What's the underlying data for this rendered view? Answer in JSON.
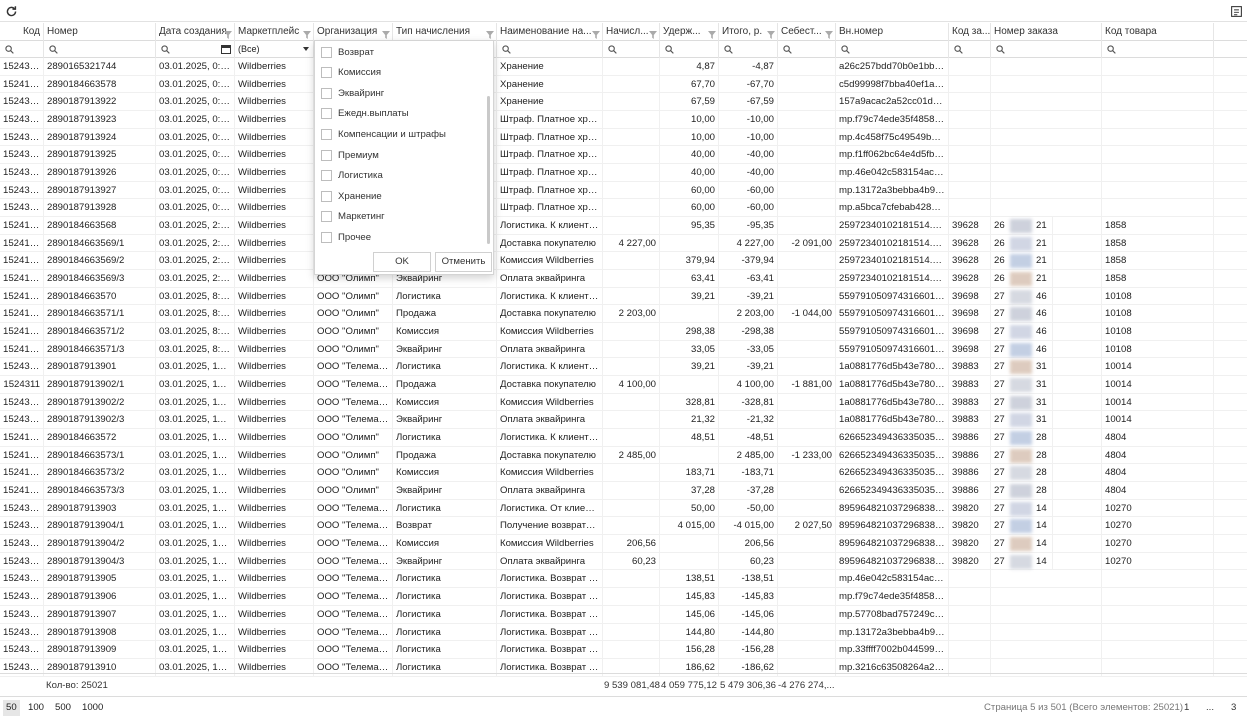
{
  "toolbar": {
    "refresh_icon": "refresh-icon",
    "export_icon": "export-icon"
  },
  "columns": [
    {
      "label": "Код"
    },
    {
      "label": "Номер"
    },
    {
      "label": "Дата создания"
    },
    {
      "label": "Маркетплейс"
    },
    {
      "label": "Организация"
    },
    {
      "label": "Тип начисления"
    },
    {
      "label": "Наименование на..."
    },
    {
      "label": "Начисл..."
    },
    {
      "label": "Удерж..."
    },
    {
      "label": "Итого, р."
    },
    {
      "label": "Себест..."
    },
    {
      "label": "Вн.номер"
    },
    {
      "label": "Код за..."
    },
    {
      "label": "Номер заказа"
    },
    {
      "label": "Код товара"
    }
  ],
  "filter": {
    "marketplace_value": "(Все)"
  },
  "rows": [
    [
      "1524392",
      "2890165321744",
      "03.01.2025, 0:00",
      "Wildberries",
      "",
      "",
      "Хранение",
      "",
      "4,87",
      "-4,87",
      "",
      "a26c257bdd70b0e1bbe...",
      "",
      "",
      ""
    ],
    [
      "1524185",
      "2890184663578",
      "03.01.2025, 0:00",
      "Wildberries",
      "",
      "",
      "Хранение",
      "",
      "67,70",
      "-67,70",
      "",
      "c5d99998f7bba40ef1a6...",
      "",
      "",
      ""
    ],
    [
      "1524327",
      "2890187913922",
      "03.01.2025, 0:00",
      "Wildberries",
      "",
      "",
      "Хранение",
      "",
      "67,59",
      "-67,59",
      "",
      "157a9acac2a52cc01dc7...",
      "",
      "",
      ""
    ],
    [
      "1524328",
      "2890187913923",
      "03.01.2025, 0:00",
      "Wildberries",
      "",
      "",
      "Штраф. Платное хра...",
      "",
      "10,00",
      "-10,00",
      "",
      "mp.f79c74ede35f48588...",
      "",
      "",
      ""
    ],
    [
      "1524329",
      "2890187913924",
      "03.01.2025, 0:00",
      "Wildberries",
      "",
      "",
      "Штраф. Платное хра...",
      "",
      "10,00",
      "-10,00",
      "",
      "mp.4c458f75c49549bca...",
      "",
      "",
      ""
    ],
    [
      "1524330",
      "2890187913925",
      "03.01.2025, 0:00",
      "Wildberries",
      "",
      "",
      "Штраф. Платное хра...",
      "",
      "40,00",
      "-40,00",
      "",
      "mp.f1ff062bc64e4d5fb6...",
      "",
      "",
      ""
    ],
    [
      "1524331",
      "2890187913926",
      "03.01.2025, 0:00",
      "Wildberries",
      "",
      "",
      "Штраф. Платное хра...",
      "",
      "40,00",
      "-40,00",
      "",
      "mp.46e042c583154acd...",
      "",
      "",
      ""
    ],
    [
      "1524332",
      "2890187913927",
      "03.01.2025, 0:00",
      "Wildberries",
      "",
      "",
      "Штраф. Платное хра...",
      "",
      "60,00",
      "-60,00",
      "",
      "mp.13172a3bebba4b94...",
      "",
      "",
      ""
    ],
    [
      "1524333",
      "2890187913928",
      "03.01.2025, 0:00",
      "Wildberries",
      "",
      "",
      "Штраф. Платное хра...",
      "",
      "60,00",
      "-60,00",
      "",
      "mp.a5bca7cfebab428b9...",
      "",
      "",
      ""
    ],
    [
      "1524173",
      "2890184663568",
      "03.01.2025, 2:30",
      "Wildberries",
      "",
      "",
      "Логистика. К клиенту...",
      "",
      "95,35",
      "-95,35",
      "",
      "25972340102181514.0.0",
      "39628",
      "26",
      "1858"
    ],
    [
      "1524174",
      "2890184663569/1",
      "03.01.2025, 2:30",
      "Wildberries",
      "",
      "",
      "Доставка покупателю",
      "4 227,00",
      "",
      "4 227,00",
      "-2 091,00",
      "25972340102181514.0.0",
      "39628",
      "26",
      "1858"
    ],
    [
      "1524175",
      "2890184663569/2",
      "03.01.2025, 2:30",
      "Wildberries",
      "",
      "",
      "Комиссия Wildberries",
      "",
      "379,94",
      "-379,94",
      "",
      "25972340102181514.0.0",
      "39628",
      "26",
      "1858"
    ],
    [
      "1524176",
      "2890184663569/3",
      "03.01.2025, 2:30",
      "Wildberries",
      "ООО \"Олимп\"",
      "Эквайринг",
      "Оплата эквайринга",
      "",
      "63,41",
      "-63,41",
      "",
      "25972340102181514.0.0",
      "39628",
      "26",
      "1858"
    ],
    [
      "1524177",
      "2890184663570",
      "03.01.2025, 8:59",
      "Wildberries",
      "ООО \"Олимп\"",
      "Логистика",
      "Логистика. К клиенту...",
      "",
      "39,21",
      "-39,21",
      "",
      "559791050974316601​0...",
      "39698",
      "27",
      "10108"
    ],
    [
      "1524178",
      "2890184663571/1",
      "03.01.2025, 8:59",
      "Wildberries",
      "ООО \"Олимп\"",
      "Продажа",
      "Доставка покупателю",
      "2 203,00",
      "",
      "2 203,00",
      "-1 044,00",
      "559791050974316601​0...",
      "39698",
      "27",
      "10108"
    ],
    [
      "1524179",
      "2890184663571/2",
      "03.01.2025, 8:59",
      "Wildberries",
      "ООО \"Олимп\"",
      "Комиссия",
      "Комиссия Wildberries",
      "",
      "298,38",
      "-298,38",
      "",
      "559791050974316601​0...",
      "39698",
      "27",
      "10108"
    ],
    [
      "1524180",
      "2890184663571/3",
      "03.01.2025, 8:59",
      "Wildberries",
      "ООО \"Олимп\"",
      "Эквайринг",
      "Оплата эквайринга",
      "",
      "33,05",
      "-33,05",
      "",
      "559791050974316601​0...",
      "39698",
      "27",
      "10108"
    ],
    [
      "1524310",
      "2890187913901",
      "03.01.2025, 11:00",
      "Wildberries",
      "ООО \"Телемак...",
      "Логистика",
      "Логистика. К клиенту...",
      "",
      "39,21",
      "-39,21",
      "",
      "1a0881776d5b43e780b...",
      "39883",
      "27",
      "10014"
    ],
    [
      "1524311",
      "2890187913902/1",
      "03.01.2025, 11:00",
      "Wildberries",
      "ООО \"Телемак...",
      "Продажа",
      "Доставка покупателю",
      "4 100,00",
      "",
      "4 100,00",
      "-1 881,00",
      "1a0881776d5b43e780b...",
      "39883",
      "27",
      "10014"
    ],
    [
      "1524312",
      "2890187913902/2",
      "03.01.2025, 11:00",
      "Wildberries",
      "ООО \"Телемак...",
      "Комиссия",
      "Комиссия Wildberries",
      "",
      "328,81",
      "-328,81",
      "",
      "1a0881776d5b43e780b...",
      "39883",
      "27",
      "10014"
    ],
    [
      "1524313",
      "2890187913902/3",
      "03.01.2025, 11:00",
      "Wildberries",
      "ООО \"Телемак...",
      "Эквайринг",
      "Оплата эквайринга",
      "",
      "21,32",
      "-21,32",
      "",
      "1a0881776d5b43e780b...",
      "39883",
      "27",
      "10014"
    ],
    [
      "1524181",
      "2890184663572",
      "03.01.2025, 15:43",
      "Wildberries",
      "ООО \"Олимп\"",
      "Логистика",
      "Логистика. К клиенту...",
      "",
      "48,51",
      "-48,51",
      "",
      "626652349436335035​3...",
      "39886",
      "27",
      "4804"
    ],
    [
      "1524182",
      "2890184663573/1",
      "03.01.2025, 15:43",
      "Wildberries",
      "ООО \"Олимп\"",
      "Продажа",
      "Доставка покупателю",
      "2 485,00",
      "",
      "2 485,00",
      "-1 233,00",
      "626652349436335035​3...",
      "39886",
      "27",
      "4804"
    ],
    [
      "1524183",
      "2890184663573/2",
      "03.01.2025, 15:43",
      "Wildberries",
      "ООО \"Олимп\"",
      "Комиссия",
      "Комиссия Wildberries",
      "",
      "183,71",
      "-183,71",
      "",
      "626652349436335035​3...",
      "39886",
      "27",
      "4804"
    ],
    [
      "1524184",
      "2890184663573/3",
      "03.01.2025, 15:43",
      "Wildberries",
      "ООО \"Олимп\"",
      "Эквайринг",
      "Оплата эквайринга",
      "",
      "37,28",
      "-37,28",
      "",
      "626652349436335035​3...",
      "39886",
      "27",
      "4804"
    ],
    [
      "1524314",
      "2890187913903",
      "03.01.2025, 16:36",
      "Wildberries",
      "ООО \"Телемак...",
      "Логистика",
      "Логистика. От клиент...",
      "",
      "50,00",
      "-50,00",
      "",
      "895964821037296838​2...",
      "39820",
      "27",
      "10270"
    ],
    [
      "1524315",
      "2890187913904/1",
      "03.01.2025, 16:36",
      "Wildberries",
      "ООО \"Телемак...",
      "Возврат",
      "Получение возврата,...",
      "",
      "4 015,00",
      "-4 015,00",
      "2 027,50",
      "895964821037296838​2...",
      "39820",
      "27",
      "10270"
    ],
    [
      "1524316",
      "2890187913904/2",
      "03.01.2025, 16:36",
      "Wildberries",
      "ООО \"Телемак...",
      "Комиссия",
      "Комиссия Wildberries",
      "206,56",
      "",
      "206,56",
      "",
      "895964821037296838​2...",
      "39820",
      "27",
      "10270"
    ],
    [
      "1524317",
      "2890187913904/3",
      "03.01.2025, 16:36",
      "Wildberries",
      "ООО \"Телемак...",
      "Эквайринг",
      "Оплата эквайринга",
      "60,23",
      "",
      "60,23",
      "",
      "895964821037296838​2...",
      "39820",
      "27",
      "10270"
    ],
    [
      "1524318",
      "2890187913905",
      "03.01.2025, 16:40",
      "Wildberries",
      "ООО \"Телемак...",
      "Логистика",
      "Логистика. Возврат т...",
      "",
      "138,51",
      "-138,51",
      "",
      "mp.46e042c583154acd...",
      "",
      "",
      ""
    ],
    [
      "1524319",
      "2890187913906",
      "03.01.2025, 16:40",
      "Wildberries",
      "ООО \"Телемак...",
      "Логистика",
      "Логистика. Возврат т...",
      "",
      "145,83",
      "-145,83",
      "",
      "mp.f79c74ede35f48588...",
      "",
      "",
      ""
    ],
    [
      "1524320",
      "2890187913907",
      "03.01.2025, 16:40",
      "Wildberries",
      "ООО \"Телемак...",
      "Логистика",
      "Логистика. Возврат т...",
      "",
      "145,06",
      "-145,06",
      "",
      "mp.57708bad757249cc...",
      "",
      "",
      ""
    ],
    [
      "1524321",
      "2890187913908",
      "03.01.2025, 16:40",
      "Wildberries",
      "ООО \"Телемак...",
      "Логистика",
      "Логистика. Возврат т...",
      "",
      "144,80",
      "-144,80",
      "",
      "mp.13172a3bebba4b94...",
      "",
      "",
      ""
    ],
    [
      "1524322",
      "2890187913909",
      "03.01.2025, 16:40",
      "Wildberries",
      "ООО \"Телемак...",
      "Логистика",
      "Логистика. Возврат т...",
      "",
      "156,28",
      "-156,28",
      "",
      "mp.33ffff7002b044599c...",
      "",
      "",
      ""
    ],
    [
      "1524323",
      "2890187913910",
      "03.01.2025, 16:40",
      "Wildberries",
      "ООО \"Телемак...",
      "Логистика",
      "Логистика. Возврат т...",
      "",
      "186,62",
      "-186,62",
      "",
      "mp.3216c63508264a2e...",
      "",
      "",
      ""
    ]
  ],
  "order_suffixes": [
    "",
    "",
    "",
    "",
    "",
    "",
    "",
    "",
    "",
    "21",
    "21",
    "21",
    "21",
    "46",
    "46",
    "46",
    "46",
    "31",
    "31",
    "31",
    "31",
    "28",
    "28",
    "28",
    "28",
    "14",
    "14",
    "14",
    "14",
    "",
    "",
    "",
    "",
    "",
    ""
  ],
  "totals": {
    "count_label": "Кол-во: 25021",
    "accrued": "9 539 081,48",
    "withheld": "4 059 775,12",
    "total": "5 479 306,36",
    "cost": "-4 276 274,..."
  },
  "footer": {
    "page_sizes": [
      "50",
      "100",
      "500",
      "1000"
    ],
    "page_info": "Страница 5 из 501 (Всего элементов: 25021)",
    "page_first": "1",
    "page_dots": "...",
    "page_last": "3"
  },
  "filter_popup": {
    "options": [
      "Возврат",
      "Комиссия",
      "Эквайринг",
      "Ежедн.выплаты",
      "Компенсации и штрафы",
      "Премиум",
      "Логистика",
      "Хранение",
      "Маркетинг",
      "Прочее"
    ],
    "ok_label": "OK",
    "cancel_label": "Отменить"
  }
}
